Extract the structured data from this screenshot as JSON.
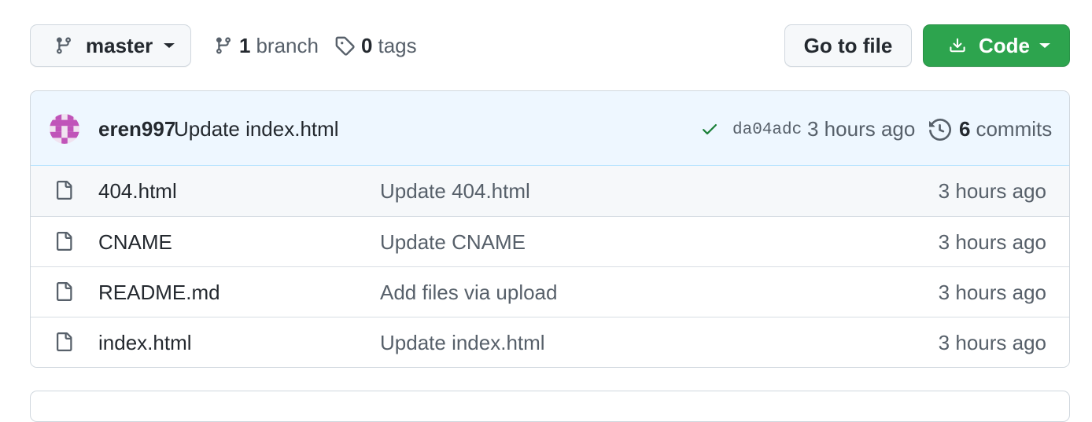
{
  "toolbar": {
    "branch_name": "master",
    "branch_count": "1",
    "branch_label": "branch",
    "tag_count": "0",
    "tag_label": "tags",
    "goto_label": "Go to file",
    "code_label": "Code"
  },
  "latest_commit": {
    "author": "eren997",
    "message": "Update index.html",
    "sha": "da04adc",
    "time": "3 hours ago",
    "commit_count": "6",
    "commit_label": "commits"
  },
  "files": [
    {
      "name": "404.html",
      "message": "Update 404.html",
      "time": "3 hours ago"
    },
    {
      "name": "CNAME",
      "message": "Update CNAME",
      "time": "3 hours ago"
    },
    {
      "name": "README.md",
      "message": "Add files via upload",
      "time": "3 hours ago"
    },
    {
      "name": "index.html",
      "message": "Update index.html",
      "time": "3 hours ago"
    }
  ],
  "colors": {
    "code_button": "#2da44e",
    "check": "#1a7f37",
    "header_bg": "#eef7ff"
  }
}
